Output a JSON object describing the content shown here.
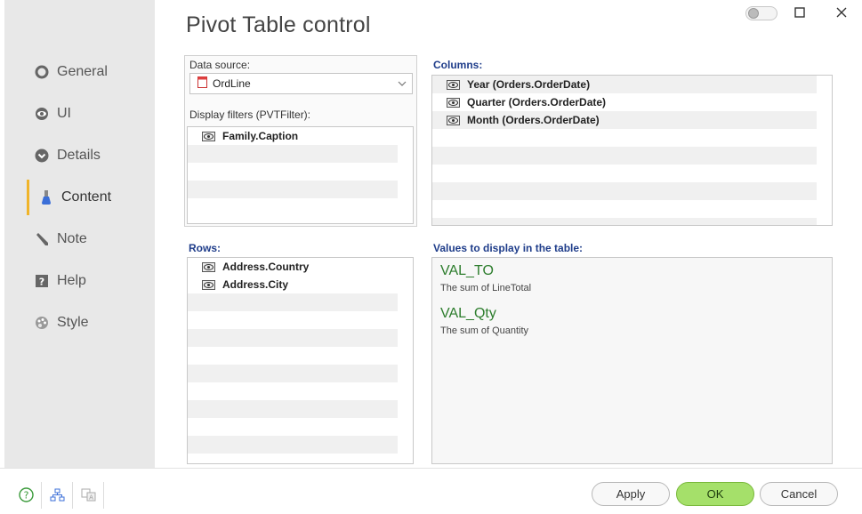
{
  "page": {
    "title": "Pivot Table control"
  },
  "sidebar": {
    "items": [
      {
        "label": "General",
        "icon": "circle-icon"
      },
      {
        "label": "UI",
        "icon": "eye-icon"
      },
      {
        "label": "Details",
        "icon": "chevron-down-circle-icon"
      },
      {
        "label": "Content",
        "icon": "flask-icon",
        "active": true
      },
      {
        "label": "Note",
        "icon": "pencil-icon"
      },
      {
        "label": "Help",
        "icon": "help-square-icon"
      },
      {
        "label": "Style",
        "icon": "palette-icon"
      }
    ]
  },
  "data_source": {
    "label": "Data source:",
    "value": "OrdLine"
  },
  "display_filters": {
    "label": "Display filters (PVTFilter):",
    "items": [
      "Family.Caption"
    ]
  },
  "columns": {
    "label": "Columns:",
    "items": [
      "Year  (Orders.OrderDate)",
      "Quarter  (Orders.OrderDate)",
      "Month  (Orders.OrderDate)"
    ]
  },
  "rows": {
    "label": "Rows:",
    "items": [
      "Address.Country",
      "Address.City"
    ]
  },
  "values": {
    "label": "Values to display in the table:",
    "items": [
      {
        "name": "VAL_TO",
        "desc": "The sum of LineTotal"
      },
      {
        "name": "VAL_Qty",
        "desc": "The sum of Quantity"
      }
    ]
  },
  "footer": {
    "apply": "Apply",
    "ok": "OK",
    "cancel": "Cancel"
  },
  "colors": {
    "accent": "#f0b429",
    "ok": "#a5e06a",
    "value_name": "#2d7d2d",
    "label_blue": "#1f3d8a"
  }
}
